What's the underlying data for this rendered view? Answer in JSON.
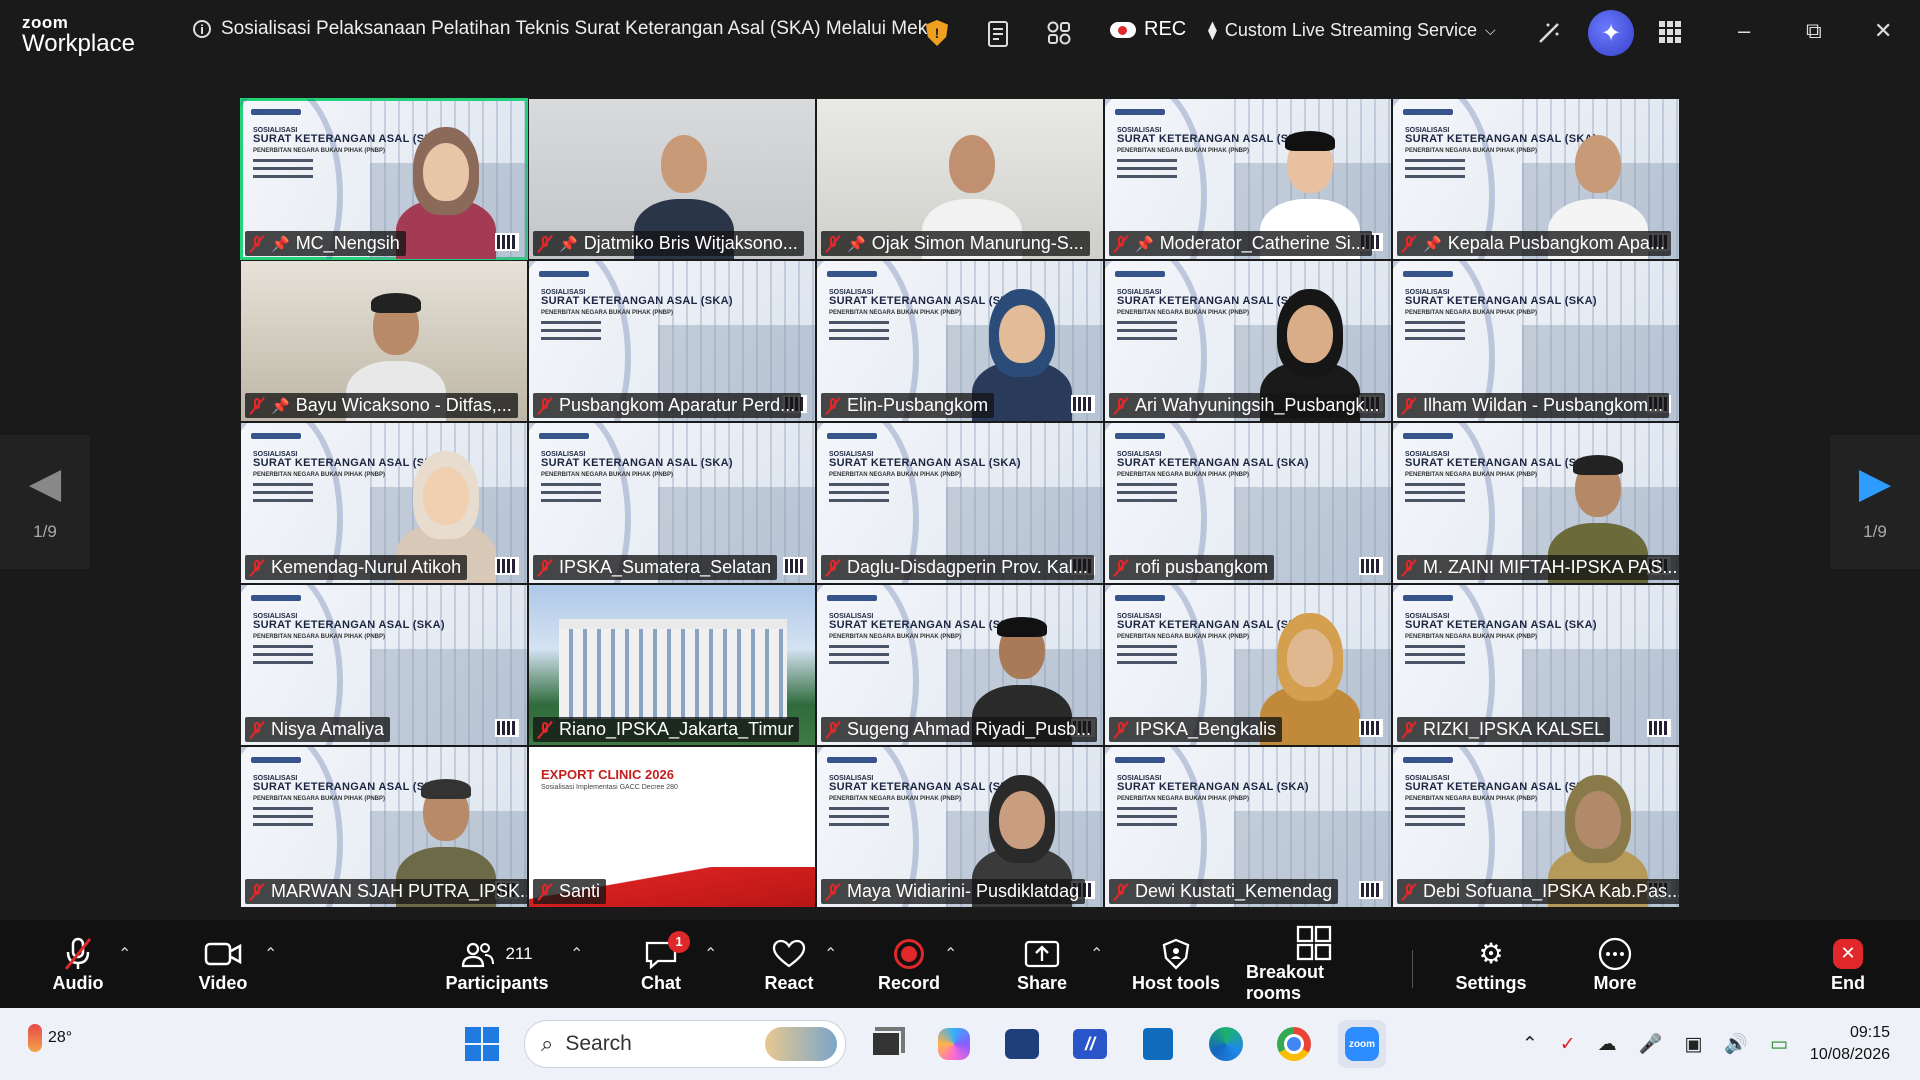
{
  "app": {
    "brand_top": "zoom",
    "brand_bottom": "Workplace"
  },
  "meeting": {
    "title": "Sosialisasi Pelaksanaan Pelatihan Teknis Surat Keterangan Asal (SKA) Melalui Mekar",
    "rec_label": "REC",
    "stream_label": "Custom Live Streaming Service",
    "page_indicator": "1/9"
  },
  "slide": {
    "line1": "SOSIALISASI",
    "line2": "SURAT KETERANGAN ASAL (SKA)",
    "line3": "PENERBITAN NEGARA BUKAN PIHAK (PNBP)"
  },
  "export_slide": {
    "title": "EXPORT CLINIC 2026",
    "subtitle": "Sosialisasi Implementasi GACC Decree 280"
  },
  "participants": [
    {
      "name": "MC_Nengsih",
      "pinned": true,
      "active": true
    },
    {
      "name": "Djatmiko Bris Witjaksono...",
      "pinned": true
    },
    {
      "name": "Ojak Simon Manurung-S...",
      "pinned": true
    },
    {
      "name": "Moderator_Catherine Si...",
      "pinned": true
    },
    {
      "name": "Kepala Pusbangkom Apa...",
      "pinned": true
    },
    {
      "name": "Bayu Wicaksono - Ditfas,...",
      "pinned": true
    },
    {
      "name": "Pusbangkom Aparatur Perd..."
    },
    {
      "name": "Elin-Pusbangkom"
    },
    {
      "name": "Ari Wahyuningsih_Pusbangk..."
    },
    {
      "name": "Ilham Wildan - Pusbangkom..."
    },
    {
      "name": "Kemendag-Nurul Atikoh"
    },
    {
      "name": "IPSKA_Sumatera_Selatan"
    },
    {
      "name": "Daglu-Disdagperin Prov. Kal..."
    },
    {
      "name": "rofi pusbangkom"
    },
    {
      "name": "M. ZAINI MIFTAH-IPSKA PAS..."
    },
    {
      "name": "Nisya Amaliya"
    },
    {
      "name": "Riano_IPSKA_Jakarta_Timur"
    },
    {
      "name": "Sugeng Ahmad Riyadi_Pusb..."
    },
    {
      "name": "IPSKA_Bengkalis"
    },
    {
      "name": "RIZKI_IPSKA KALSEL"
    },
    {
      "name": "MARWAN SJAH PUTRA_IPSK..."
    },
    {
      "name": "Santi"
    },
    {
      "name": "Maya Widiarini- Pusdiklatdag"
    },
    {
      "name": "Dewi Kustati_Kemendag"
    },
    {
      "name": "Debi Sofuana_IPSKA Kab.Pas..."
    }
  ],
  "toolbar": {
    "audio": "Audio",
    "video": "Video",
    "participants": "Participants",
    "participants_count": "211",
    "chat": "Chat",
    "chat_badge": "1",
    "react": "React",
    "record": "Record",
    "share": "Share",
    "host_tools": "Host tools",
    "breakout": "Breakout rooms",
    "settings": "Settings",
    "more": "More",
    "end": "End"
  },
  "taskbar": {
    "temperature": "28°",
    "search_placeholder": "Search",
    "time": "09:15",
    "date": "10/08/2026"
  },
  "colors": {
    "active_speaker": "#22d37a",
    "muted": "#e0282a",
    "record": "#e0282a",
    "shield": "#f0a020",
    "accent": "#4a5cff"
  }
}
